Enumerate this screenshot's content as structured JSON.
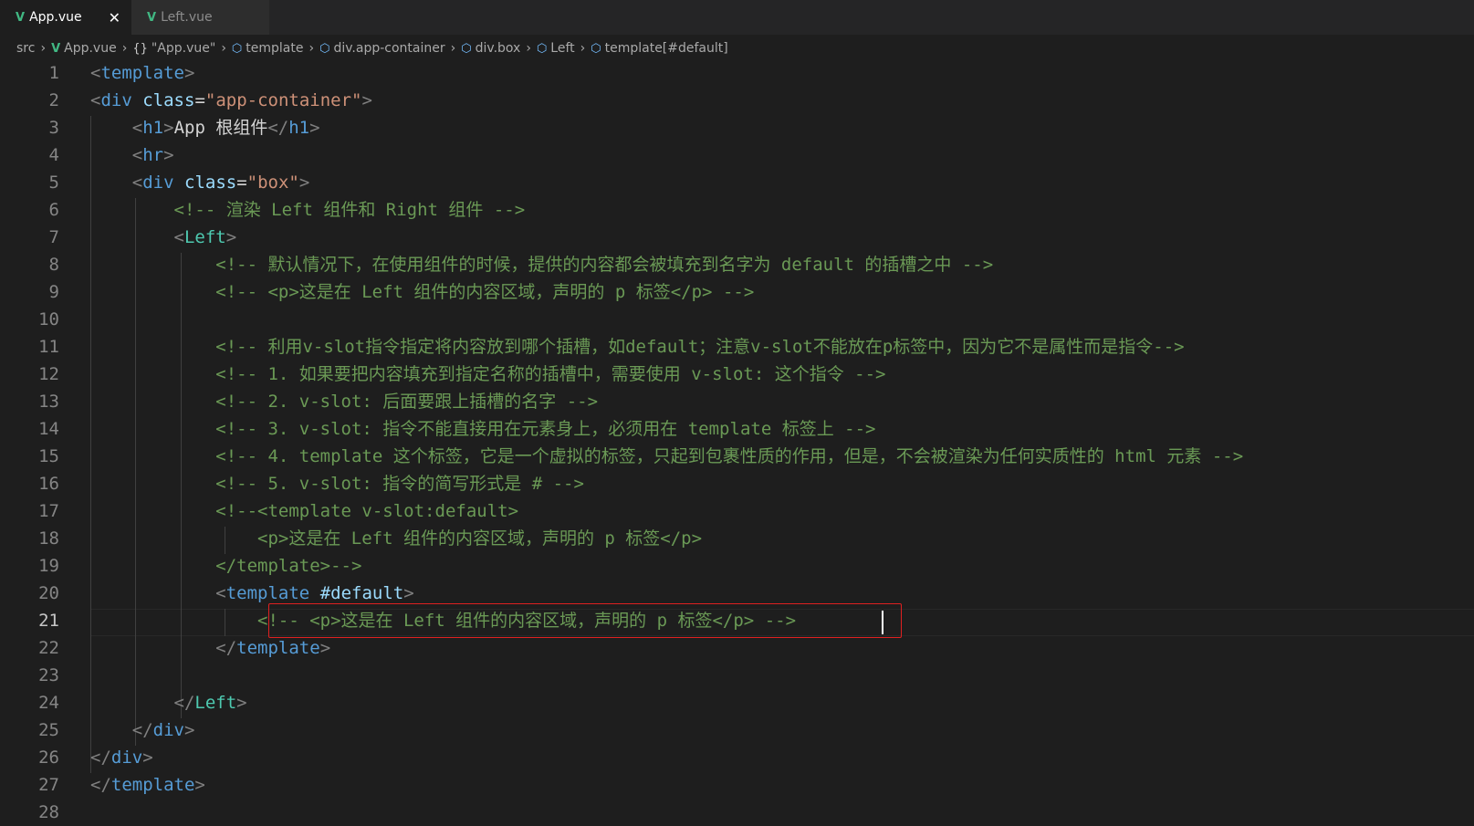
{
  "tabs": [
    {
      "label": "App.vue",
      "icon": "V",
      "active": true,
      "close": "✕"
    },
    {
      "label": "Left.vue",
      "icon": "V",
      "active": false
    }
  ],
  "breadcrumb": {
    "src": "src",
    "file": "App.vue",
    "script": "\"App.vue\"",
    "script_icon": "{}",
    "nodes": [
      "template",
      "div.app-container",
      "div.box",
      "Left",
      "template[#default]"
    ]
  },
  "editor": {
    "current_line": 21,
    "line_numbers": [
      "1",
      "2",
      "3",
      "4",
      "5",
      "6",
      "7",
      "8",
      "9",
      "10",
      "11",
      "12",
      "13",
      "14",
      "15",
      "16",
      "17",
      "18",
      "19",
      "20",
      "21",
      "22",
      "23",
      "24",
      "25",
      "26",
      "27",
      "28"
    ],
    "lines": [
      [
        {
          "t": "<",
          "c": "br"
        },
        {
          "t": "template",
          "c": "tag"
        },
        {
          "t": ">",
          "c": "br"
        }
      ],
      [
        {
          "t": "<",
          "c": "br"
        },
        {
          "t": "div",
          "c": "tag"
        },
        {
          "t": " ",
          "c": "txt"
        },
        {
          "t": "class",
          "c": "attr"
        },
        {
          "t": "=",
          "c": "txt"
        },
        {
          "t": "\"app-container\"",
          "c": "str"
        },
        {
          "t": ">",
          "c": "br"
        }
      ],
      [
        {
          "t": "    ",
          "c": "txt"
        },
        {
          "t": "<",
          "c": "br"
        },
        {
          "t": "h1",
          "c": "tag"
        },
        {
          "t": ">",
          "c": "br"
        },
        {
          "t": "App 根组件",
          "c": "txt"
        },
        {
          "t": "</",
          "c": "br"
        },
        {
          "t": "h1",
          "c": "tag"
        },
        {
          "t": ">",
          "c": "br"
        }
      ],
      [
        {
          "t": "    ",
          "c": "txt"
        },
        {
          "t": "<",
          "c": "br"
        },
        {
          "t": "hr",
          "c": "tag"
        },
        {
          "t": ">",
          "c": "br"
        }
      ],
      [
        {
          "t": "    ",
          "c": "txt"
        },
        {
          "t": "<",
          "c": "br"
        },
        {
          "t": "div",
          "c": "tag"
        },
        {
          "t": " ",
          "c": "txt"
        },
        {
          "t": "class",
          "c": "attr"
        },
        {
          "t": "=",
          "c": "txt"
        },
        {
          "t": "\"box\"",
          "c": "str"
        },
        {
          "t": ">",
          "c": "br"
        }
      ],
      [
        {
          "t": "        ",
          "c": "txt"
        },
        {
          "t": "<!-- 渲染 Left 组件和 Right 组件 -->",
          "c": "cmt"
        }
      ],
      [
        {
          "t": "        ",
          "c": "txt"
        },
        {
          "t": "<",
          "c": "br"
        },
        {
          "t": "Left",
          "c": "comp"
        },
        {
          "t": ">",
          "c": "br"
        }
      ],
      [
        {
          "t": "            ",
          "c": "txt"
        },
        {
          "t": "<!-- 默认情况下，在使用组件的时候，提供的内容都会被填充到名字为 default 的插槽之中 -->",
          "c": "cmt"
        }
      ],
      [
        {
          "t": "            ",
          "c": "txt"
        },
        {
          "t": "<!-- <p>这是在 Left 组件的内容区域，声明的 p 标签</p> -->",
          "c": "cmt"
        }
      ],
      [],
      [
        {
          "t": "            ",
          "c": "txt"
        },
        {
          "t": "<!-- 利用v-slot指令指定将内容放到哪个插槽，如default；注意v-slot不能放在p标签中，因为它不是属性而是指令-->",
          "c": "cmt"
        }
      ],
      [
        {
          "t": "            ",
          "c": "txt"
        },
        {
          "t": "<!-- 1. 如果要把内容填充到指定名称的插槽中，需要使用 v-slot: 这个指令 -->",
          "c": "cmt"
        }
      ],
      [
        {
          "t": "            ",
          "c": "txt"
        },
        {
          "t": "<!-- 2. v-slot: 后面要跟上插槽的名字 -->",
          "c": "cmt"
        }
      ],
      [
        {
          "t": "            ",
          "c": "txt"
        },
        {
          "t": "<!-- 3. v-slot: 指令不能直接用在元素身上，必须用在 template 标签上 -->",
          "c": "cmt"
        }
      ],
      [
        {
          "t": "            ",
          "c": "txt"
        },
        {
          "t": "<!-- 4. template 这个标签，它是一个虚拟的标签，只起到包裹性质的作用，但是，不会被渲染为任何实质性的 html 元素 -->",
          "c": "cmt"
        }
      ],
      [
        {
          "t": "            ",
          "c": "txt"
        },
        {
          "t": "<!-- 5. v-slot: 指令的简写形式是 # -->",
          "c": "cmt"
        }
      ],
      [
        {
          "t": "            ",
          "c": "txt"
        },
        {
          "t": "<!--<template v-slot:default>",
          "c": "cmt"
        }
      ],
      [
        {
          "t": "                ",
          "c": "txt"
        },
        {
          "t": "<p>这是在 Left 组件的内容区域，声明的 p 标签</p>",
          "c": "cmt"
        }
      ],
      [
        {
          "t": "            ",
          "c": "txt"
        },
        {
          "t": "</template>-->",
          "c": "cmt"
        }
      ],
      [
        {
          "t": "            ",
          "c": "txt"
        },
        {
          "t": "<",
          "c": "br"
        },
        {
          "t": "template",
          "c": "tag"
        },
        {
          "t": " ",
          "c": "txt"
        },
        {
          "t": "#default",
          "c": "attr"
        },
        {
          "t": ">",
          "c": "br"
        }
      ],
      [
        {
          "t": "                ",
          "c": "txt"
        },
        {
          "t": "<!-- <p>这是在 Left 组件的内容区域，声明的 p 标签</p> -->",
          "c": "cmt"
        }
      ],
      [
        {
          "t": "            ",
          "c": "txt"
        },
        {
          "t": "</",
          "c": "br"
        },
        {
          "t": "template",
          "c": "tag"
        },
        {
          "t": ">",
          "c": "br"
        }
      ],
      [],
      [
        {
          "t": "        ",
          "c": "txt"
        },
        {
          "t": "</",
          "c": "br"
        },
        {
          "t": "Left",
          "c": "comp"
        },
        {
          "t": ">",
          "c": "br"
        }
      ],
      [
        {
          "t": "    ",
          "c": "txt"
        },
        {
          "t": "</",
          "c": "br"
        },
        {
          "t": "div",
          "c": "tag"
        },
        {
          "t": ">",
          "c": "br"
        }
      ],
      [
        {
          "t": "</",
          "c": "br"
        },
        {
          "t": "div",
          "c": "tag"
        },
        {
          "t": ">",
          "c": "br"
        }
      ],
      [
        {
          "t": "</",
          "c": "br"
        },
        {
          "t": "template",
          "c": "tag"
        },
        {
          "t": ">",
          "c": "br"
        }
      ],
      []
    ]
  },
  "colors": {
    "background": "#1e1e1e",
    "tag": "#569cd6",
    "attribute": "#9cdcfe",
    "string": "#ce9178",
    "comment": "#6a9955",
    "component": "#4ec9b0",
    "highlight_box": "#e02020"
  }
}
